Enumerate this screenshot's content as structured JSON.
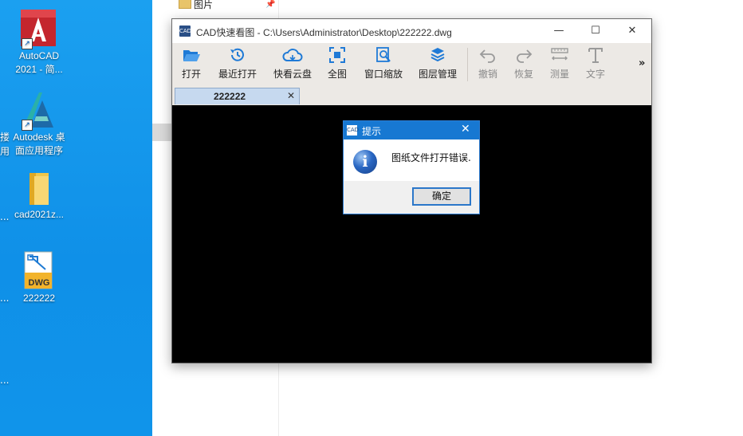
{
  "desktop": {
    "icons": [
      {
        "name": "autocad-2021",
        "label_line1": "AutoCAD",
        "label_line2": "2021 - 简..."
      },
      {
        "name": "autodesk-desktop-app",
        "label_line1": "Autodesk 桌",
        "label_line2": "面应用程序"
      },
      {
        "name": "cad2021-folder",
        "label_line1": "cad2021z..."
      },
      {
        "name": "dwg-file",
        "label_line1": "222222",
        "badge": "DWG"
      }
    ],
    "edge_labels": [
      "搂",
      "用",
      "...",
      "...",
      "..."
    ]
  },
  "explorer": {
    "row_label": "图片",
    "pin_glyph": "📌"
  },
  "cad_window": {
    "title": "CAD快速看图 - C:\\Users\\Administrator\\Desktop\\222222.dwg",
    "app_icon_text": "CAD",
    "controls": {
      "minimize": "—",
      "maximize": "☐",
      "close": "✕"
    },
    "toolbar": [
      {
        "label": "打开",
        "icon": "folder-open-icon",
        "enabled": true
      },
      {
        "label": "最近打开",
        "icon": "history-icon",
        "enabled": true
      },
      {
        "label": "快看云盘",
        "icon": "cloud-icon",
        "enabled": true
      },
      {
        "label": "全图",
        "icon": "fit-all-icon",
        "enabled": true
      },
      {
        "label": "窗口缩放",
        "icon": "zoom-window-icon",
        "enabled": true
      },
      {
        "label": "图层管理",
        "icon": "layers-icon",
        "enabled": true
      },
      {
        "label": "撤销",
        "icon": "undo-icon",
        "enabled": false
      },
      {
        "label": "恢复",
        "icon": "redo-icon",
        "enabled": false
      },
      {
        "label": "测量",
        "icon": "measure-icon",
        "enabled": false
      },
      {
        "label": "文字",
        "icon": "text-icon",
        "enabled": false
      }
    ],
    "more_label": "»",
    "tab": {
      "label": "222222",
      "close": "✕"
    }
  },
  "dialog": {
    "title": "提示",
    "icon_text": "CAD",
    "close": "✕",
    "info_glyph": "i",
    "message": "图纸文件打开错误.",
    "ok_label": "确定"
  },
  "colors": {
    "desktop_blue": "#0f90e8",
    "toolbar_icon_blue": "#1f7ad6",
    "dialog_title_blue": "#1778d2"
  }
}
